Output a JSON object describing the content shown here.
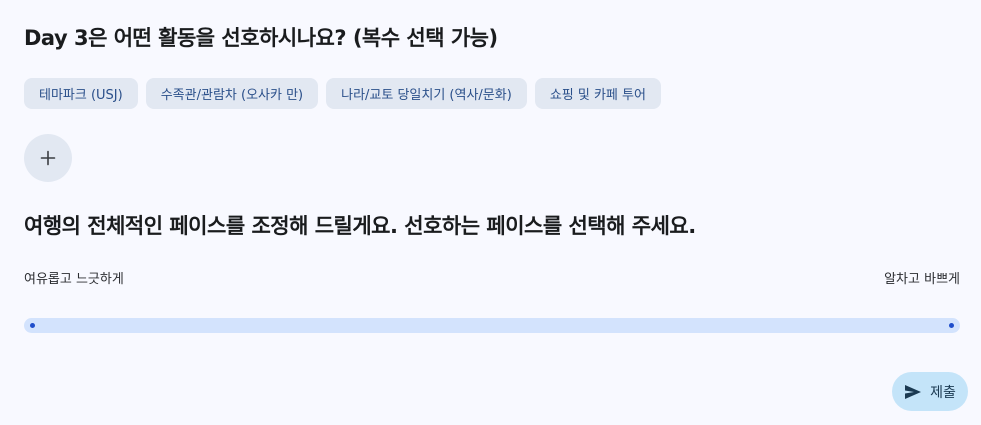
{
  "question1": {
    "title": "Day 3은 어떤 활동을 선호하시나요? (복수 선택 가능)",
    "options": [
      "테마파크 (USJ)",
      "수족관/관람차 (오사카 만)",
      "나라/교토 당일치기 (역사/문화)",
      "쇼핑 및 카페 투어"
    ],
    "add_icon": "plus-icon"
  },
  "question2": {
    "title": "여행의 전체적인 페이스를 조정해 드릴게요. 선호하는 페이스를 선택해 주세요.",
    "min_label": "여유롭고 느긋하게",
    "max_label": "알차고 바쁘게"
  },
  "submit": {
    "label": "제출",
    "icon": "send-icon"
  },
  "colors": {
    "background": "#f8f9ff",
    "chip_bg": "#e2e8f2",
    "chip_text": "#2a4f8a",
    "slider_track": "#d3e3fd",
    "slider_dot": "#1f4ecb",
    "submit_bg": "#c4e4f9"
  }
}
